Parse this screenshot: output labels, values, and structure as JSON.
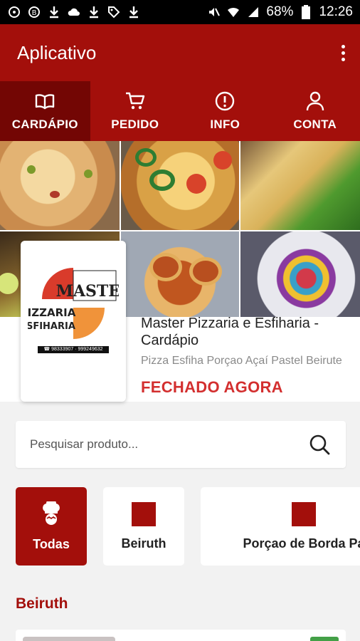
{
  "status_bar": {
    "battery": "68%",
    "time": "12:26"
  },
  "app_bar": {
    "title": "Aplicativo"
  },
  "tabs": [
    {
      "label": "CARDÁPIO",
      "icon": "book-open-icon",
      "active": true
    },
    {
      "label": "PEDIDO",
      "icon": "cart-icon",
      "active": false
    },
    {
      "label": "INFO",
      "icon": "info-icon",
      "active": false
    },
    {
      "label": "CONTA",
      "icon": "user-icon",
      "active": false
    }
  ],
  "store": {
    "name": "Master Pizzaria e Esfiharia - Cardápio",
    "description": "Pizza Esfiha Porçao Açaí Pastel Beirute",
    "status": "FECHADO AGORA",
    "logo": {
      "text_top": "MASTER",
      "text_mid": "PIZZARIA",
      "text_bottom": "ESFIHARIA",
      "phone": "☎ 98333907 · 999249632"
    }
  },
  "search": {
    "placeholder": "Pesquisar produto..."
  },
  "categories": [
    {
      "label": "Todas",
      "active": true,
      "icon": "chef-icon"
    },
    {
      "label": "Beiruth",
      "active": false
    },
    {
      "label": "Porçao de Borda Pa",
      "active": false
    }
  ],
  "section": {
    "title": "Beiruth"
  },
  "colors": {
    "primary": "#a30f0b",
    "primary_dark": "#730604",
    "status_closed": "#d32f2f",
    "badge_green": "#43a047"
  }
}
